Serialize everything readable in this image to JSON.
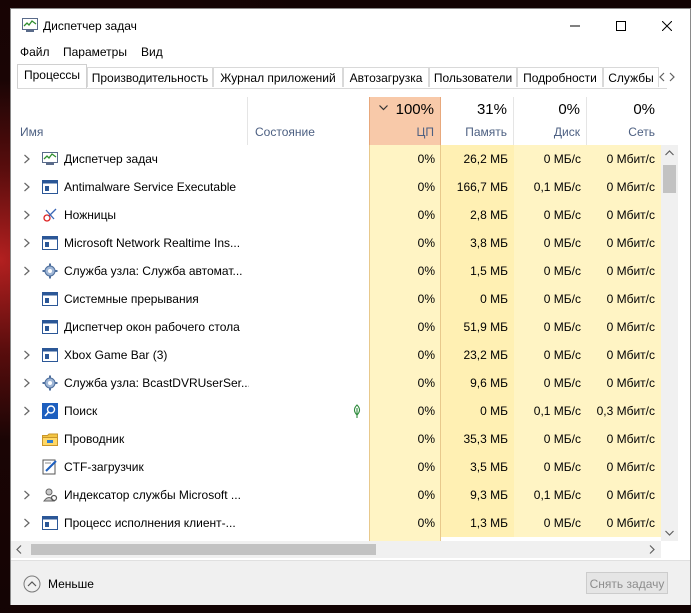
{
  "window": {
    "title": "Диспетчер задач"
  },
  "menu": [
    "Файл",
    "Параметры",
    "Вид"
  ],
  "tabs": [
    "Процессы",
    "Производительность",
    "Журнал приложений",
    "Автозагрузка",
    "Пользователи",
    "Подробности",
    "Службы"
  ],
  "columns": {
    "name": "Имя",
    "status": "Состояние",
    "cpu": {
      "pct": "100%",
      "label": "ЦП"
    },
    "mem": {
      "pct": "31%",
      "label": "Память"
    },
    "disk": {
      "pct": "0%",
      "label": "Диск"
    },
    "net": {
      "pct": "0%",
      "label": "Сеть"
    }
  },
  "processes": [
    {
      "name": "Диспетчер задач",
      "icon": "task-manager-icon",
      "cpu": "0%",
      "mem": "26,2 МБ",
      "disk": "0 МБ/с",
      "net": "0 Мбит/с",
      "expandable": true,
      "status_icon": ""
    },
    {
      "name": "Antimalware Service Executable",
      "icon": "service-app-icon",
      "cpu": "0%",
      "mem": "166,7 МБ",
      "disk": "0,1 МБ/с",
      "net": "0 Мбит/с",
      "expandable": true,
      "status_icon": ""
    },
    {
      "name": "Ножницы",
      "icon": "scissors-icon",
      "cpu": "0%",
      "mem": "2,8 МБ",
      "disk": "0 МБ/с",
      "net": "0 Мбит/с",
      "expandable": true,
      "status_icon": ""
    },
    {
      "name": "Microsoft Network Realtime Ins...",
      "icon": "service-app-icon",
      "cpu": "0%",
      "mem": "3,8 МБ",
      "disk": "0 МБ/с",
      "net": "0 Мбит/с",
      "expandable": true,
      "status_icon": ""
    },
    {
      "name": "Служба узла: Служба автомат...",
      "icon": "gear-icon",
      "cpu": "0%",
      "mem": "1,5 МБ",
      "disk": "0 МБ/с",
      "net": "0 Мбит/с",
      "expandable": true,
      "status_icon": ""
    },
    {
      "name": "Системные прерывания",
      "icon": "service-app-icon",
      "cpu": "0%",
      "mem": "0 МБ",
      "disk": "0 МБ/с",
      "net": "0 Мбит/с",
      "expandable": false,
      "status_icon": ""
    },
    {
      "name": "Диспетчер окон рабочего стола",
      "icon": "service-app-icon",
      "cpu": "0%",
      "mem": "51,9 МБ",
      "disk": "0 МБ/с",
      "net": "0 Мбит/с",
      "expandable": false,
      "status_icon": ""
    },
    {
      "name": "Xbox Game Bar (3)",
      "icon": "service-app-icon",
      "cpu": "0%",
      "mem": "23,2 МБ",
      "disk": "0 МБ/с",
      "net": "0 Мбит/с",
      "expandable": true,
      "status_icon": ""
    },
    {
      "name": "Служба узла: BcastDVRUserSer...",
      "icon": "gear-icon",
      "cpu": "0%",
      "mem": "9,6 МБ",
      "disk": "0 МБ/с",
      "net": "0 Мбит/с",
      "expandable": true,
      "status_icon": ""
    },
    {
      "name": "Поиск",
      "icon": "search-icon",
      "cpu": "0%",
      "mem": "0 МБ",
      "disk": "0,1 МБ/с",
      "net": "0,3 Мбит/с",
      "expandable": true,
      "status_icon": "leaf-icon"
    },
    {
      "name": "Проводник",
      "icon": "folder-icon",
      "cpu": "0%",
      "mem": "35,3 МБ",
      "disk": "0 МБ/с",
      "net": "0 Мбит/с",
      "expandable": false,
      "status_icon": ""
    },
    {
      "name": "CTF-загрузчик",
      "icon": "pen-icon",
      "cpu": "0%",
      "mem": "3,5 МБ",
      "disk": "0 МБ/с",
      "net": "0 Мбит/с",
      "expandable": false,
      "status_icon": ""
    },
    {
      "name": "Индексатор службы Microsoft ...",
      "icon": "indexer-icon",
      "cpu": "0%",
      "mem": "9,3 МБ",
      "disk": "0,1 МБ/с",
      "net": "0 Мбит/с",
      "expandable": true,
      "status_icon": ""
    },
    {
      "name": "Процесс исполнения клиент-...",
      "icon": "service-app-icon",
      "cpu": "0%",
      "mem": "1,3 МБ",
      "disk": "0 МБ/с",
      "net": "0 Мбит/с",
      "expandable": true,
      "status_icon": ""
    }
  ],
  "footer": {
    "less_label": "Меньше",
    "end_task_label": "Снять задачу"
  },
  "colors": {
    "cpu_header": "#f8c9a9",
    "cpu_cell": "#fff4c4",
    "mem_cell": "#fff0b3",
    "cell": "#fff4c4",
    "accent": "#4d6082"
  }
}
